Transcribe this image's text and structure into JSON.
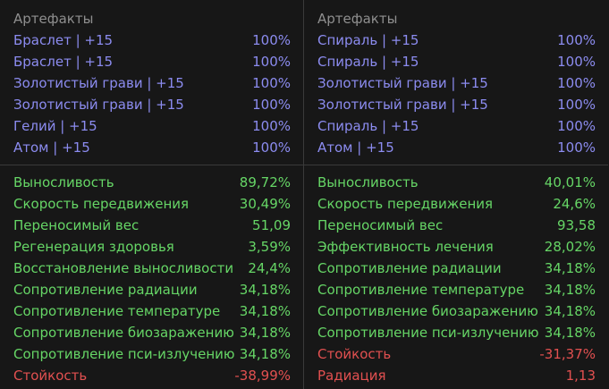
{
  "left": {
    "heading": "Артефакты",
    "artifacts": [
      {
        "name": "Браслет | +15",
        "value": "100%"
      },
      {
        "name": "Браслет | +15",
        "value": "100%"
      },
      {
        "name": "Золотистый грави | +15",
        "value": "100%"
      },
      {
        "name": "Золотистый грави | +15",
        "value": "100%"
      },
      {
        "name": "Гелий | +15",
        "value": "100%"
      },
      {
        "name": "Атом | +15",
        "value": "100%"
      }
    ],
    "stats": [
      {
        "name": "Выносливость",
        "value": "89,72%",
        "tone": "pos"
      },
      {
        "name": "Скорость передвижения",
        "value": "30,49%",
        "tone": "pos"
      },
      {
        "name": "Переносимый вес",
        "value": "51,09",
        "tone": "pos"
      },
      {
        "name": "Регенерация здоровья",
        "value": "3,59%",
        "tone": "pos"
      },
      {
        "name": "Восстановление выносливости",
        "value": "24,4%",
        "tone": "pos"
      },
      {
        "name": "Сопротивление радиации",
        "value": "34,18%",
        "tone": "pos"
      },
      {
        "name": "Сопротивление температуре",
        "value": "34,18%",
        "tone": "pos"
      },
      {
        "name": "Сопротивление биозаражению",
        "value": "34,18%",
        "tone": "pos"
      },
      {
        "name": "Сопротивление пси-излучению",
        "value": "34,18%",
        "tone": "pos"
      },
      {
        "name": "Стойкость",
        "value": "-38,99%",
        "tone": "neg"
      }
    ]
  },
  "right": {
    "heading": "Артефакты",
    "artifacts": [
      {
        "name": "Спираль | +15",
        "value": "100%"
      },
      {
        "name": "Спираль | +15",
        "value": "100%"
      },
      {
        "name": "Золотистый грави | +15",
        "value": "100%"
      },
      {
        "name": "Золотистый грави | +15",
        "value": "100%"
      },
      {
        "name": "Спираль | +15",
        "value": "100%"
      },
      {
        "name": "Атом | +15",
        "value": "100%"
      }
    ],
    "stats": [
      {
        "name": "Выносливость",
        "value": "40,01%",
        "tone": "pos"
      },
      {
        "name": "Скорость передвижения",
        "value": "24,6%",
        "tone": "pos"
      },
      {
        "name": "Переносимый вес",
        "value": "93,58",
        "tone": "pos"
      },
      {
        "name": "Эффективность лечения",
        "value": "28,02%",
        "tone": "pos"
      },
      {
        "name": "Сопротивление радиации",
        "value": "34,18%",
        "tone": "pos"
      },
      {
        "name": "Сопротивление температуре",
        "value": "34,18%",
        "tone": "pos"
      },
      {
        "name": "Сопротивление биозаражению",
        "value": "34,18%",
        "tone": "pos"
      },
      {
        "name": "Сопротивление пси-излучению",
        "value": "34,18%",
        "tone": "pos"
      },
      {
        "name": "Стойкость",
        "value": "-31,37%",
        "tone": "neg"
      },
      {
        "name": "Радиация",
        "value": "1,13",
        "tone": "neg"
      }
    ]
  },
  "colors": {
    "artifact": "#8c8cf0",
    "positive": "#66d666",
    "negative": "#e25050",
    "heading": "#8f8f8f",
    "background": "#171717"
  }
}
